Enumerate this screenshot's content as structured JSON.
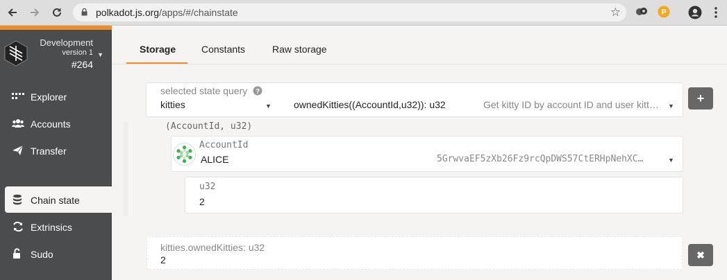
{
  "browser": {
    "url_host": "polkadot.js.org",
    "url_path": "/apps/#/chainstate"
  },
  "sidebar": {
    "chain_name": "Development",
    "version": "version 1",
    "block": "#264",
    "items": [
      {
        "label": "Explorer",
        "icon": "explorer-icon"
      },
      {
        "label": "Accounts",
        "icon": "users-icon"
      },
      {
        "label": "Transfer",
        "icon": "send-icon"
      },
      {
        "label": "Chain state",
        "icon": "database-icon"
      },
      {
        "label": "Extrinsics",
        "icon": "sync-icon"
      },
      {
        "label": "Sudo",
        "icon": "unlock-icon"
      }
    ],
    "active_index": 3
  },
  "tabs": [
    {
      "label": "Storage"
    },
    {
      "label": "Constants"
    },
    {
      "label": "Raw storage"
    }
  ],
  "query": {
    "label": "selected state query",
    "module": "kitties",
    "method": "ownedKitties((AccountId,u32)): u32",
    "description": "Get kitty ID by account ID and user kitt…",
    "add_button": "+"
  },
  "params": {
    "tuple_label": "(AccountId, u32)",
    "account": {
      "label": "AccountId",
      "name": "ALICE",
      "address": "5GrwvaEF5zXb26Fz9rcQpDWS57CtERHpNehXC…"
    },
    "u32": {
      "label": "u32",
      "value": "2"
    }
  },
  "result": {
    "label": "kitties.ownedKitties: u32",
    "value": "2",
    "remove_button": "✖"
  },
  "colors": {
    "accent": "#f08b29",
    "sidebar": "#4b4c4d",
    "button": "#666766"
  }
}
